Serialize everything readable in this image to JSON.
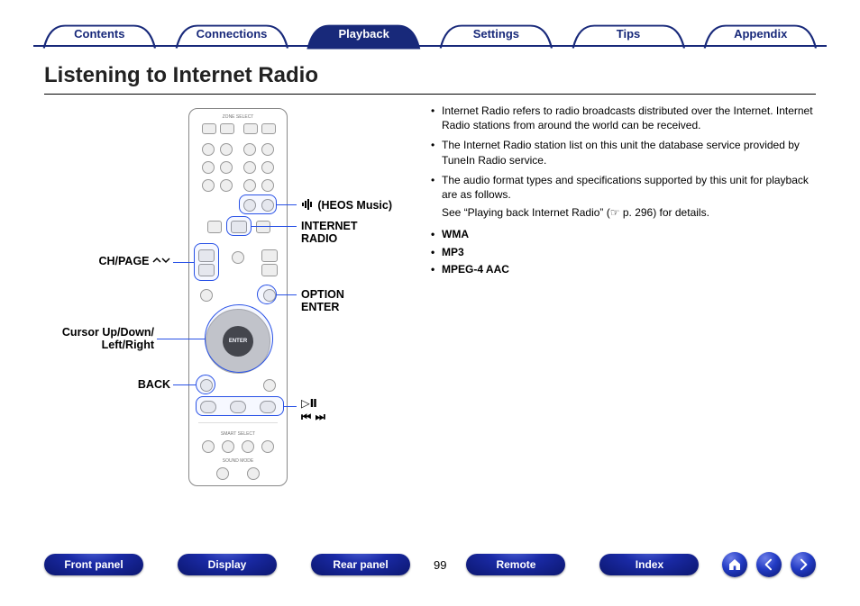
{
  "tabs": {
    "items": [
      {
        "label": "Contents",
        "active": false
      },
      {
        "label": "Connections",
        "active": false
      },
      {
        "label": "Playback",
        "active": true
      },
      {
        "label": "Settings",
        "active": false
      },
      {
        "label": "Tips",
        "active": false
      },
      {
        "label": "Appendix",
        "active": false
      }
    ]
  },
  "title": "Listening to Internet Radio",
  "callouts": {
    "heos": "(HEOS Music)",
    "internet_radio_1": "INTERNET",
    "internet_radio_2": "RADIO",
    "option": "OPTION",
    "enter": "ENTER",
    "chpage": "CH/PAGE",
    "cursor_1": "Cursor Up/Down/",
    "cursor_2": "Left/Right",
    "back": "BACK",
    "play_pause": "▷Ⅱ",
    "prev_next": "⏮ ⏭"
  },
  "body": {
    "b1": "Internet Radio refers to radio broadcasts distributed over the Internet. Internet Radio stations from around the world can be received.",
    "b2": "The Internet Radio station list on this unit the database service provided by TuneIn Radio service.",
    "b3": "The audio format types and specifications supported by this unit for playback are as follows.",
    "see": "See “Playing back Internet Radio” (☞ p. 296) for details.",
    "formats": [
      "WMA",
      "MP3",
      "MPEG-4 AAC"
    ]
  },
  "bottom": {
    "links": [
      "Front panel",
      "Display",
      "Rear panel",
      "Remote",
      "Index"
    ],
    "page": "99"
  }
}
